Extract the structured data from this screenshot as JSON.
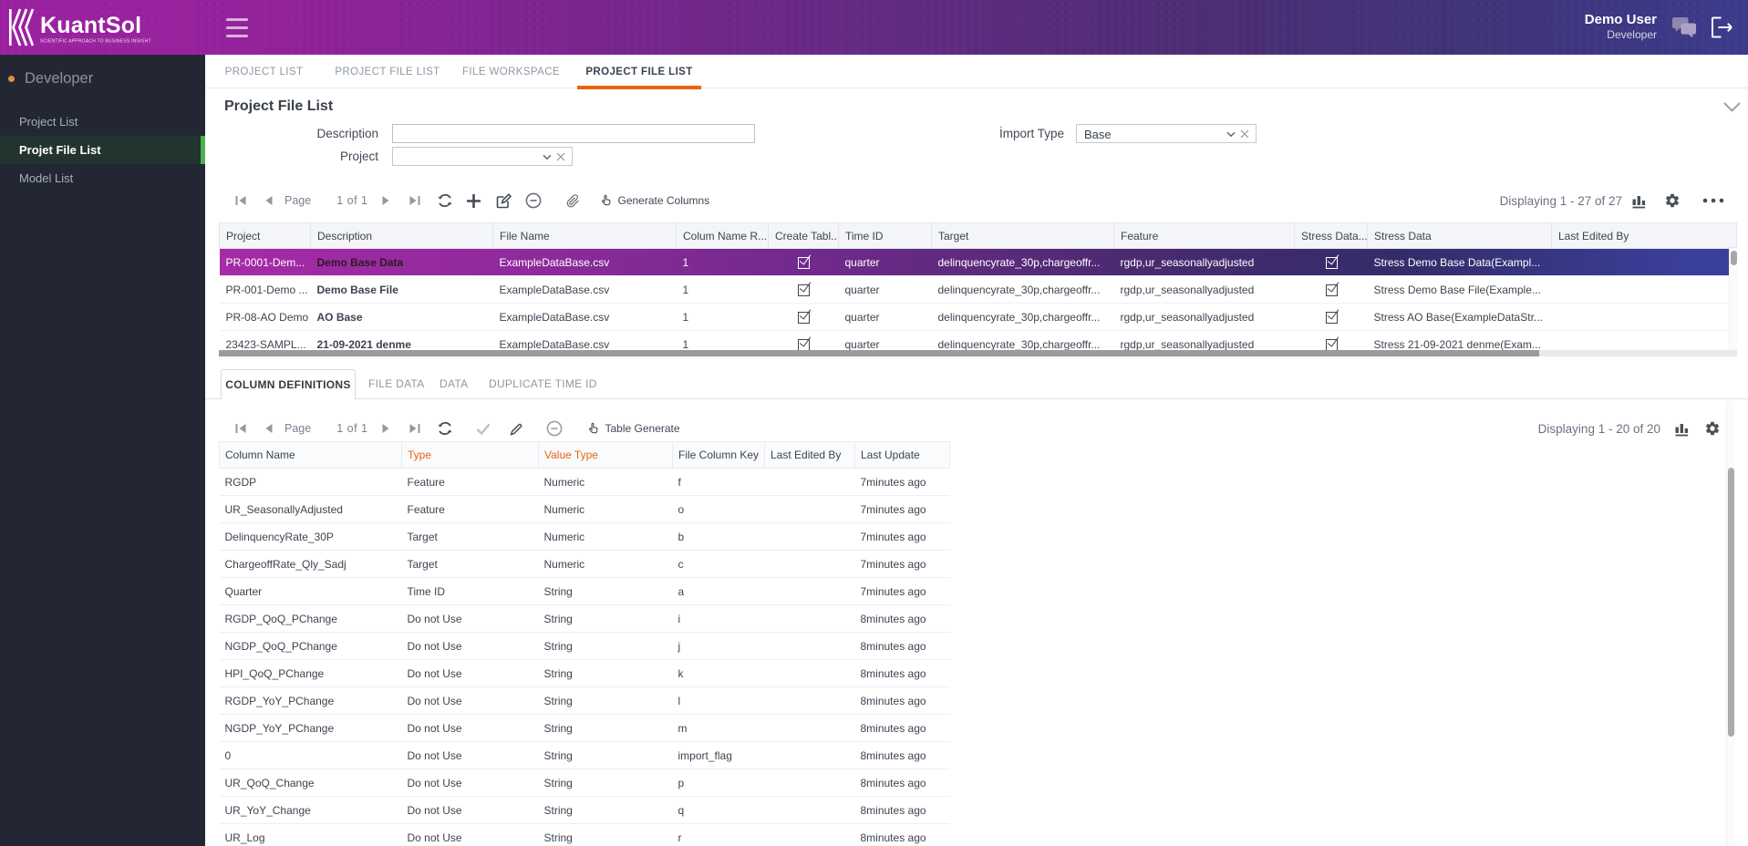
{
  "header": {
    "brand": "KuantSol",
    "tagline": "SCIENTIFIC APPROACH TO BUSINESS INSIGHT",
    "user_name": "Demo User",
    "user_role": "Developer"
  },
  "sidebar": {
    "section": "Developer",
    "items": [
      {
        "label": "Project List",
        "active": false
      },
      {
        "label": "Projet File List",
        "active": true
      },
      {
        "label": "Model List",
        "active": false
      }
    ]
  },
  "tabs": [
    {
      "label": "PROJECT LIST",
      "active": false
    },
    {
      "label": "PROJECT FILE LIST",
      "active": false
    },
    {
      "label": "FILE WORKSPACE",
      "active": false
    },
    {
      "label": "PROJECT FILE LIST",
      "active": true
    }
  ],
  "panel": {
    "title": "Project File List",
    "filters": {
      "description": {
        "label": "Description",
        "value": ""
      },
      "project": {
        "label": "Project",
        "value": ""
      },
      "import_type": {
        "label": "İmport Type",
        "value": "Base"
      }
    },
    "toolbar": {
      "page_label": "Page",
      "page_value": "1 of 1",
      "action_label": "Generate Columns",
      "displaying": "Displaying 1 - 27 of 27"
    },
    "grid": {
      "columns": [
        "Project",
        "Description",
        "File Name",
        "Colum Name R...",
        "Create Tabl...",
        "Time ID",
        "Target",
        "Feature",
        "Stress Data...",
        "Stress Data",
        "Last Edited By"
      ],
      "rows": [
        {
          "selected": true,
          "cells": [
            "PR-0001-Dem...",
            "Demo Base Data",
            "ExampleDataBase.csv",
            "1",
            true,
            "quarter",
            "delinquencyrate_30p,chargeoffr...",
            "rgdp,ur_seasonallyadjusted",
            true,
            "Stress Demo Base Data(Exampl...",
            ""
          ]
        },
        {
          "selected": false,
          "cells": [
            "PR-001-Demo ...",
            "Demo Base File",
            "ExampleDataBase.csv",
            "1",
            true,
            "quarter",
            "delinquencyrate_30p,chargeoffr...",
            "rgdp,ur_seasonallyadjusted",
            true,
            "Stress Demo Base File(Example...",
            ""
          ]
        },
        {
          "selected": false,
          "cells": [
            "PR-08-AO Demo",
            "AO Base",
            "ExampleDataBase.csv",
            "1",
            true,
            "quarter",
            "delinquencyrate_30p,chargeoffr...",
            "rgdp,ur_seasonallyadjusted",
            true,
            "Stress AO Base(ExampleDataStr...",
            ""
          ]
        },
        {
          "selected": false,
          "cells": [
            "23423-SAMPL...",
            "21-09-2021 denme",
            "ExampleDataBase.csv",
            "1",
            true,
            "quarter",
            "delinquencyrate_30p,chargeoffr...",
            "rgdp,ur_seasonallyadjusted",
            true,
            "Stress 21-09-2021 denme(Exam...",
            ""
          ]
        }
      ]
    }
  },
  "details": {
    "tabs": [
      {
        "label": "COLUMN DEFINITIONS",
        "active": true
      },
      {
        "label": "FILE DATA",
        "active": false
      },
      {
        "label": "DATA",
        "active": false
      },
      {
        "label": "DUPLICATE TIME ID",
        "active": false
      }
    ],
    "toolbar": {
      "page_label": "Page",
      "page_value": "1 of 1",
      "action_label": "Table Generate",
      "displaying": "Displaying 1 - 20 of 20"
    },
    "grid": {
      "columns": [
        "Column Name",
        "Type",
        "Value Type",
        "File Column Key",
        "Last Edited By",
        "Last Update"
      ],
      "rows": [
        {
          "cells": [
            "RGDP",
            "Feature",
            "Numeric",
            "f",
            "",
            "7minutes ago"
          ]
        },
        {
          "cells": [
            "UR_SeasonallyAdjusted",
            "Feature",
            "Numeric",
            "o",
            "",
            "7minutes ago"
          ]
        },
        {
          "cells": [
            "DelinquencyRate_30P",
            "Target",
            "Numeric",
            "b",
            "",
            "7minutes ago"
          ]
        },
        {
          "cells": [
            "ChargeoffRate_Qly_Sadj",
            "Target",
            "Numeric",
            "c",
            "",
            "7minutes ago"
          ]
        },
        {
          "cells": [
            "Quarter",
            "Time ID",
            "String",
            "a",
            "",
            "7minutes ago"
          ]
        },
        {
          "cells": [
            "RGDP_QoQ_PChange",
            "Do not Use",
            "String",
            "i",
            "",
            "8minutes ago"
          ]
        },
        {
          "cells": [
            "NGDP_QoQ_PChange",
            "Do not Use",
            "String",
            "j",
            "",
            "8minutes ago"
          ]
        },
        {
          "cells": [
            "HPI_QoQ_PChange",
            "Do not Use",
            "String",
            "k",
            "",
            "8minutes ago"
          ]
        },
        {
          "cells": [
            "RGDP_YoY_PChange",
            "Do not Use",
            "String",
            "l",
            "",
            "8minutes ago"
          ]
        },
        {
          "cells": [
            "NGDP_YoY_PChange",
            "Do not Use",
            "String",
            "m",
            "",
            "8minutes ago"
          ]
        },
        {
          "cells": [
            "0",
            "Do not Use",
            "String",
            "import_flag",
            "",
            "8minutes ago"
          ]
        },
        {
          "cells": [
            "UR_QoQ_Change",
            "Do not Use",
            "String",
            "p",
            "",
            "8minutes ago"
          ]
        },
        {
          "cells": [
            "UR_YoY_Change",
            "Do not Use",
            "String",
            "q",
            "",
            "8minutes ago"
          ]
        },
        {
          "cells": [
            "UR_Log",
            "Do not Use",
            "String",
            "r",
            "",
            "8minutes ago"
          ]
        }
      ]
    }
  }
}
